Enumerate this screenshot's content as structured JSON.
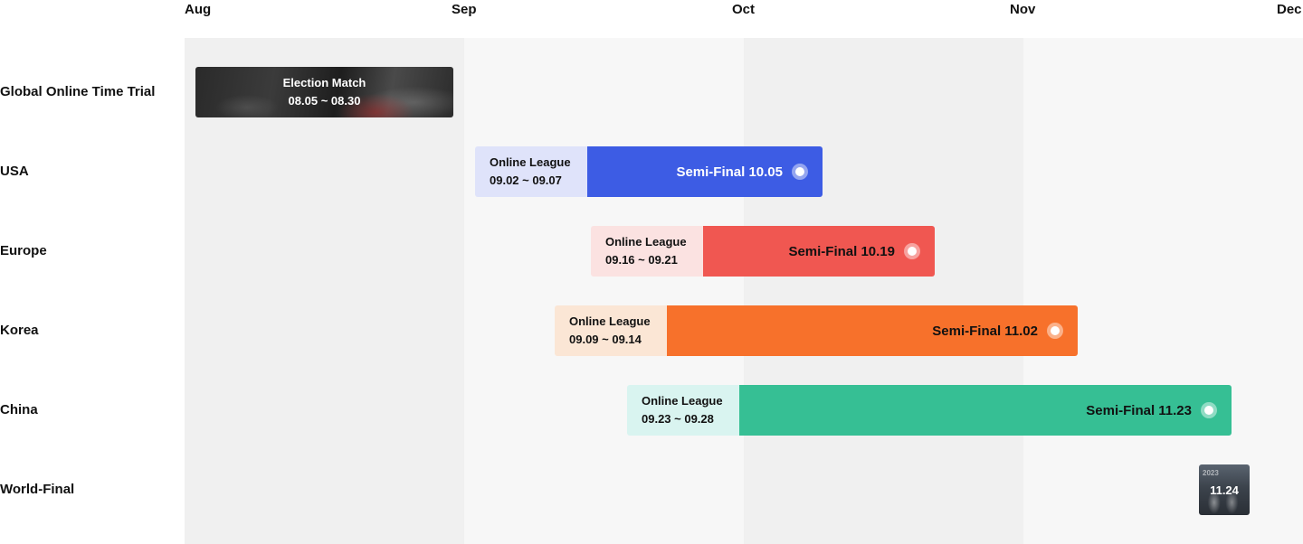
{
  "months": [
    {
      "label": "Aug"
    },
    {
      "label": "Sep"
    },
    {
      "label": "Oct"
    },
    {
      "label": "Nov"
    },
    {
      "label": "Dec"
    }
  ],
  "rows": [
    {
      "label": "Global Online Time Trial"
    },
    {
      "label": "USA"
    },
    {
      "label": "Europe"
    },
    {
      "label": "Korea"
    },
    {
      "label": "China"
    },
    {
      "label": "World-Final"
    }
  ],
  "election": {
    "title": "Election Match",
    "dates": "08.05 ~ 08.30"
  },
  "regions": [
    {
      "league_title": "Online League",
      "league_dates": "09.02 ~ 09.07",
      "semi_label": "Semi-Final 10.05"
    },
    {
      "league_title": "Online League",
      "league_dates": "09.16 ~ 09.21",
      "semi_label": "Semi-Final 10.19"
    },
    {
      "league_title": "Online League",
      "league_dates": "09.09 ~ 09.14",
      "semi_label": "Semi-Final 11.02"
    },
    {
      "league_title": "Online League",
      "league_dates": "09.23 ~ 09.28",
      "semi_label": "Semi-Final 11.23"
    }
  ],
  "world_final": {
    "year": "2023",
    "date": "11.24"
  },
  "colors": {
    "usa": "#3d5ce4",
    "usa_light": "#dfe3fa",
    "europe": "#f05751",
    "europe_light": "#fbe2e1",
    "korea": "#f7712b",
    "korea_light": "#fbe6d5",
    "china": "#36bf94",
    "china_light": "#d9f4f0",
    "col_dark": "#f0f0f0",
    "col_light": "#f7f7f7"
  }
}
